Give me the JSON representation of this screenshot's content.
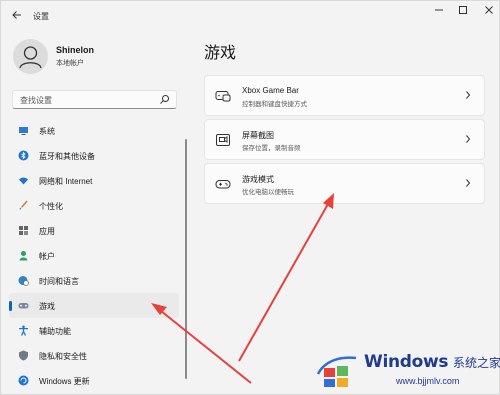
{
  "window": {
    "title": "设置",
    "back_icon": "back-arrow-icon",
    "controls": [
      "minimize-icon",
      "maximize-icon",
      "close-icon"
    ]
  },
  "user": {
    "name": "Shinelon",
    "account_type": "本地帐户"
  },
  "search": {
    "placeholder": "查找设置"
  },
  "sidebar": {
    "items": [
      {
        "label": "系统",
        "icon": "monitor-icon",
        "active": false
      },
      {
        "label": "蓝牙和其他设备",
        "icon": "bluetooth-icon",
        "active": false
      },
      {
        "label": "网络和 Internet",
        "icon": "wifi-icon",
        "active": false
      },
      {
        "label": "个性化",
        "icon": "brush-icon",
        "active": false
      },
      {
        "label": "应用",
        "icon": "apps-icon",
        "active": false
      },
      {
        "label": "帐户",
        "icon": "person-icon",
        "active": false
      },
      {
        "label": "时间和语言",
        "icon": "globe-clock-icon",
        "active": false
      },
      {
        "label": "游戏",
        "icon": "gamepad-icon",
        "active": true
      },
      {
        "label": "辅助功能",
        "icon": "accessibility-icon",
        "active": false
      },
      {
        "label": "隐私和安全性",
        "icon": "shield-icon",
        "active": false
      },
      {
        "label": "Windows 更新",
        "icon": "update-icon",
        "active": false
      }
    ]
  },
  "main": {
    "title": "游戏",
    "cards": [
      {
        "title": "Xbox Game Bar",
        "subtitle": "控制器和键盘快捷方式",
        "icon": "game-bar-icon"
      },
      {
        "title": "屏幕截图",
        "subtitle": "保存位置，录制音频",
        "icon": "capture-icon"
      },
      {
        "title": "游戏模式",
        "subtitle": "优化电脑以便畅玩",
        "icon": "gamepad-icon"
      }
    ]
  },
  "watermark": {
    "brand": "Windows",
    "brand_cn": "系统之家",
    "url": "www.bjjmlv.com"
  },
  "colors": {
    "accent": "#0067c0",
    "background": "#f3f3f3",
    "card": "#fbfbfb",
    "arrow": "#e8413c"
  }
}
